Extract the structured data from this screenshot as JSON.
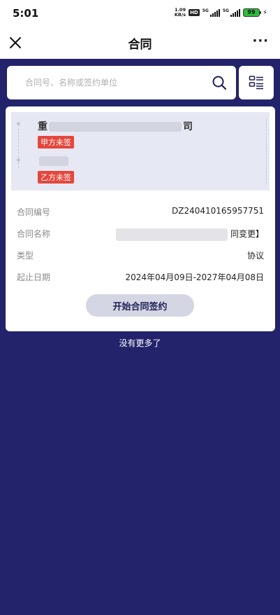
{
  "status_bar": {
    "time": "5:01",
    "net_speed_value": "1.09",
    "net_speed_unit": "KB/s",
    "hd_label": "HD",
    "signal1_label": "5G",
    "signal2_label": "5G",
    "battery_level": "99"
  },
  "nav": {
    "title": "合同",
    "more_label": "···"
  },
  "search": {
    "placeholder": "合同号、名称或签约单位"
  },
  "contract": {
    "party_a_name_start": "重",
    "party_a_name_end": "司",
    "party_a_status": "甲方未签",
    "party_b_name_start": "",
    "party_b_status": "乙方未签",
    "fields": [
      {
        "label": "合同编号",
        "value": "DZ240410165957751"
      },
      {
        "label": "合同名称",
        "value": "同变更】"
      },
      {
        "label": "类型",
        "value": "协议"
      },
      {
        "label": "起止日期",
        "value": "2024年04月09日-2027年04月08日"
      }
    ],
    "sign_button_label": "开始合同签约"
  },
  "list_footer": "没有更多了",
  "colors": {
    "page_background": "#22236a",
    "badge_red": "#e5463c",
    "button_bg": "#d5d6e3"
  }
}
